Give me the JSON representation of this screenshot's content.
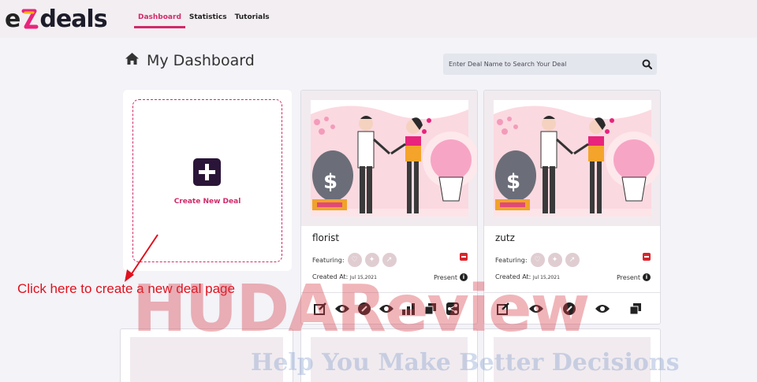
{
  "app": {
    "logo_text": "deals",
    "logo_prefix": "e"
  },
  "nav": [
    {
      "label": "Dashboard",
      "active": true
    },
    {
      "label": "Statistics",
      "active": false
    },
    {
      "label": "Tutorials",
      "active": false
    }
  ],
  "page": {
    "title": "My Dashboard"
  },
  "search": {
    "placeholder": "Enter Deal Name to Search Your Deal"
  },
  "create": {
    "label": "Create New Deal"
  },
  "hint": "Click here to create a new deal page",
  "deals": [
    {
      "name": "florist",
      "featuring_label": "Featuring:",
      "created_label": "Created At:",
      "created_date": "Jul 15,2021",
      "status": "Present"
    },
    {
      "name": "zutz",
      "featuring_label": "Featuring:",
      "created_label": "Created At:",
      "created_date": "Jul 15,2021",
      "status": "Present"
    }
  ],
  "watermark": {
    "main": "HUDAReview",
    "sub": "Help You Make Better Decisions"
  },
  "colors": {
    "accent": "#d12a6a",
    "dark": "#2a1538",
    "background": "#f3f3f8",
    "danger": "#d8242c"
  },
  "icons": [
    "home-icon",
    "search-icon",
    "plus-icon",
    "heart-icon",
    "fire-icon",
    "trend-icon",
    "remove-icon",
    "info-icon",
    "edit-icon",
    "eye-icon",
    "paperclip-icon",
    "bar-chart-icon",
    "copy-icon",
    "share-icon"
  ]
}
